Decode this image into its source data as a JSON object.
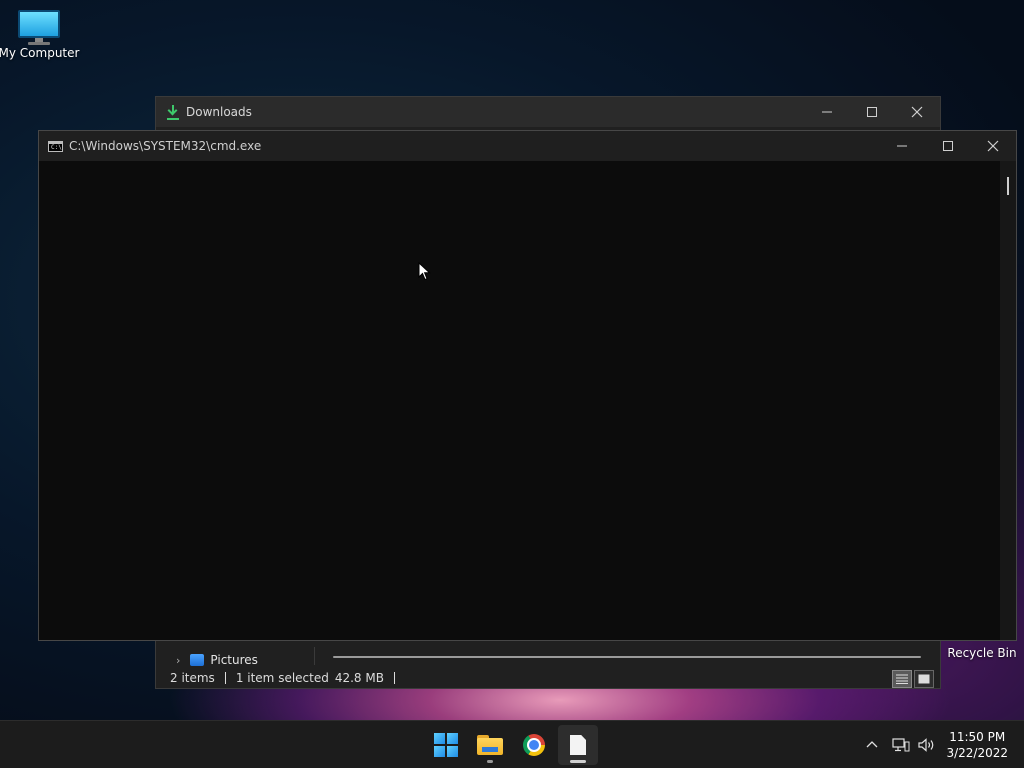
{
  "desktop": {
    "icons": [
      {
        "label": "My Computer"
      },
      {
        "label": "Recycle Bin"
      }
    ]
  },
  "downloads_window": {
    "title": "Downloads",
    "nav_item": "Pictures",
    "status": {
      "items": "2 items",
      "selected": "1 item selected",
      "size": "42.8 MB"
    }
  },
  "cmd_window": {
    "title": "C:\\Windows\\SYSTEM32\\cmd.exe",
    "icon_text": "C:\\"
  },
  "taskbar": {
    "apps": [
      "start",
      "file-explorer",
      "chrome",
      "notepad"
    ],
    "time": "11:50 PM",
    "date": "3/22/2022"
  },
  "colors": {
    "accent": "#3ec86b",
    "taskbar": "#1c1c1c",
    "console_bg": "#0c0c0c"
  }
}
